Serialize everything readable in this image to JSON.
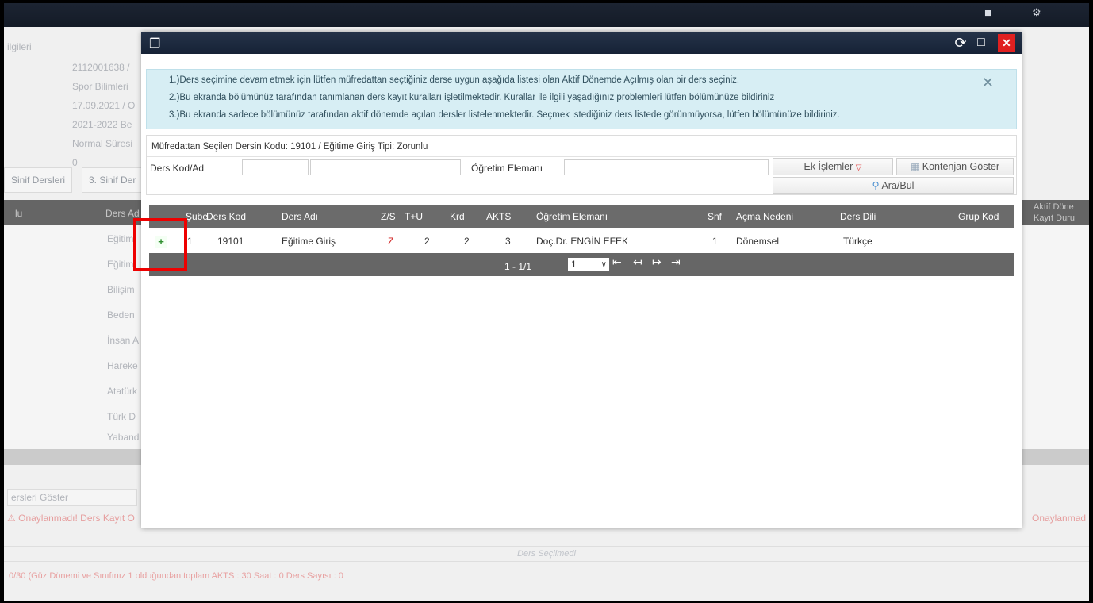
{
  "background": {
    "student_info_label": "ilgileri",
    "info_lines": [
      "2112001638 /",
      "Spor Bilimleri",
      "17.09.2021 / O",
      "2021-2022 Be",
      "Normal Süresi",
      "0"
    ],
    "tabs": [
      "Sinif Dersleri",
      "3. Sinif Der"
    ],
    "table_header_left": "lu",
    "table_header_course": "Ders Ad",
    "table_header_right_1": "Aktif Döne",
    "table_header_right_2": "Kayıt Duru",
    "rows": [
      "Eğitim",
      "Eğitim",
      "Bilişim",
      "Beden",
      "İnsan A",
      "Hareke",
      "Atatürk",
      "Türk D",
      "Yaband"
    ],
    "show_courses_button": "ersleri Göster",
    "warning_left": "Onaylanmadı! Ders Kayıt O",
    "warning_right": "Onaylanmad",
    "no_course_selected": "Ders Seçilmedi",
    "footer_summary": "0/30 (Güz Dönemi ve Sınıfınız 1 olduğundan toplam AKTS : 30 Saat : 0 Ders Sayısı : 0"
  },
  "modal": {
    "info": {
      "line1": "1.)Ders seçimine devam etmek için lütfen müfredattan seçtiğiniz derse uygun aşağıda listesi olan Aktif Dönemde Açılmış olan bir ders seçiniz.",
      "line2": "2.)Bu ekranda bölümünüz tarafından tanımlanan ders kayıt kuralları işletilmektedir. Kurallar ile ilgili yaşadığınız problemleri lütfen bölümünüze bildiriniz",
      "line3": "3.)Bu ekranda sadece bölümünüz tarafından aktif dönemde açılan dersler listelenmektedir. Seçmek istediğiniz ders listede görünmüyorsa, lütfen bölümünüze bildiriniz."
    },
    "form": {
      "title": "Müfredattan Seçilen Dersin Kodu: 19101 / Eğitime Giriş Tipi: Zorunlu",
      "course_label": "Ders Kod/Ad",
      "course_code_value": "",
      "course_name_value": "",
      "instructor_label": "Öğretim Elemanı",
      "instructor_value": "",
      "extra_button": "Ek İşlemler",
      "quota_button": "Kontenjan Göster",
      "search_button": "Ara/Bul"
    },
    "grid": {
      "headers": {
        "section": "Şube",
        "code": "Ders Kod",
        "name": "Ders Adı",
        "zs": "Z/S",
        "tu": "T+U",
        "credit": "Krd",
        "ects": "AKTS",
        "instructor": "Öğretim Elemanı",
        "grade": "Snf",
        "reason": "Açma Nedeni",
        "language": "Ders Dili",
        "group": "Grup Kod"
      },
      "rows": [
        {
          "section": "1",
          "code": "19101",
          "name": "Eğitime Giriş",
          "zs": "Z",
          "tu": "2",
          "credit": "2",
          "ects": "3",
          "instructor": "Doç.Dr. ENGİN EFEK",
          "grade": "1",
          "reason": "Dönemsel",
          "language": "Türkçe",
          "group": ""
        }
      ]
    },
    "pager": {
      "range": "1 - 1/1",
      "page": "1"
    }
  },
  "colors": {
    "accent_red": "#e00000",
    "header_dark": "#1c2a3e",
    "info_bg": "#d7eef4",
    "grid_header": "#6b6b6b",
    "zs_red": "#d02020"
  }
}
